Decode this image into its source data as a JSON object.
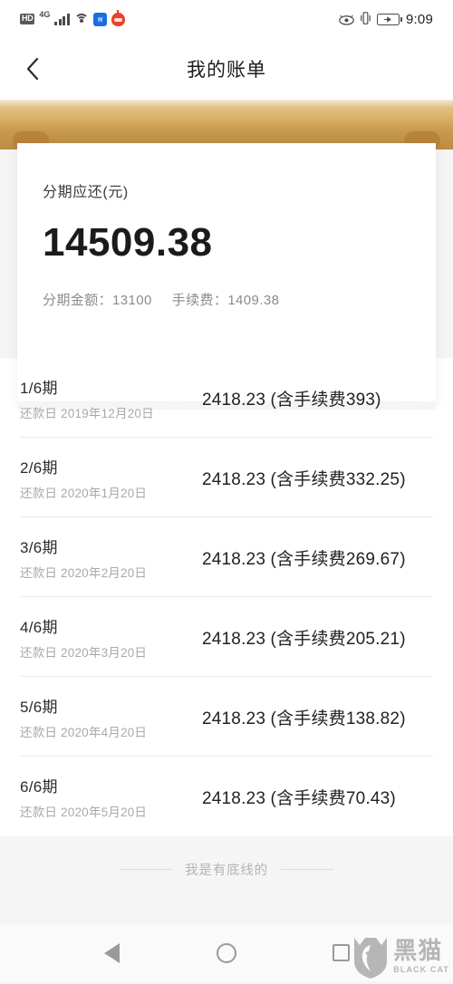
{
  "statusbar": {
    "icons": [
      "hd-icon",
      "network-4g-icon",
      "signal-bars-icon",
      "wifi-icon",
      "app-badge-icon",
      "app-badge-red-icon"
    ],
    "hd_label": "HD",
    "network_label": "4G",
    "right_icons": [
      "eye-care-icon",
      "vibrate-icon",
      "battery-charging-icon"
    ],
    "time": "9:09"
  },
  "navbar": {
    "back_icon": "chevron-left-icon",
    "title": "我的账单"
  },
  "card": {
    "label": "分期应还(元)",
    "amount": "14509.38",
    "principal_label": "分期金额：13100",
    "fee_label": "手续费：1409.38"
  },
  "installments": [
    {
      "term": "1/6期",
      "date": "还款日 2019年12月20日",
      "amount": "2418.23 (含手续费393)"
    },
    {
      "term": "2/6期",
      "date": "还款日 2020年1月20日",
      "amount": "2418.23 (含手续费332.25)"
    },
    {
      "term": "3/6期",
      "date": "还款日 2020年2月20日",
      "amount": "2418.23 (含手续费269.67)"
    },
    {
      "term": "4/6期",
      "date": "还款日 2020年3月20日",
      "amount": "2418.23 (含手续费205.21)"
    },
    {
      "term": "5/6期",
      "date": "还款日 2020年4月20日",
      "amount": "2418.23 (含手续费138.82)"
    },
    {
      "term": "6/6期",
      "date": "还款日 2020年5月20日",
      "amount": "2418.23 (含手续费70.43)"
    }
  ],
  "footer": {
    "text": "我是有底线的"
  },
  "androidnav": {
    "back_icon": "triangle-back-icon",
    "home_icon": "circle-home-icon",
    "recents_icon": "square-recents-icon"
  },
  "watermark": {
    "cn": "黑猫",
    "en": "BLACK CAT",
    "logo_icon": "black-cat-shield-icon"
  },
  "colors": {
    "gold_light": "#e2c184",
    "gold_dark": "#bb8c42",
    "gold_tab": "#b8833c",
    "page_bg": "#f5f5f5",
    "text_primary": "#1b1b1b",
    "text_muted": "#a9a9a9"
  }
}
